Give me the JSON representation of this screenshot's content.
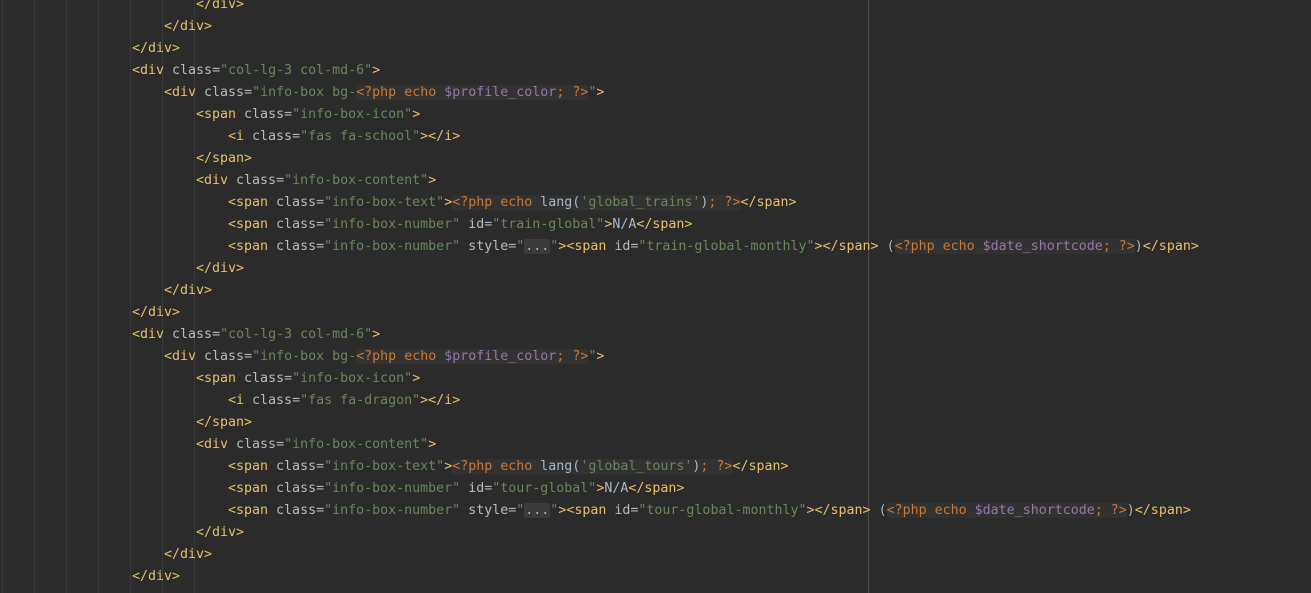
{
  "editor": {
    "language": "php",
    "lines": [
      [
        [
          "t",
          "</div>"
        ]
      ],
      [
        [
          "t",
          "</div>"
        ]
      ],
      [
        [
          "t",
          "</div>"
        ]
      ],
      [
        [
          "t",
          "<div "
        ],
        [
          "a",
          "class"
        ],
        [
          "o",
          "="
        ],
        [
          "s",
          "\"col-lg-3 col-md-6\""
        ],
        [
          "t",
          ">"
        ]
      ],
      [
        [
          "t",
          "<div "
        ],
        [
          "a",
          "class"
        ],
        [
          "o",
          "="
        ],
        [
          "s",
          "\"info-box bg-"
        ],
        [
          "php",
          "<?php "
        ],
        [
          "php",
          "echo "
        ],
        [
          "v",
          "$profile_color"
        ],
        [
          "php",
          "; ?>"
        ],
        [
          "s",
          "\""
        ],
        [
          "t",
          ">"
        ]
      ],
      [
        [
          "t",
          "<span "
        ],
        [
          "a",
          "class"
        ],
        [
          "o",
          "="
        ],
        [
          "s",
          "\"info-box-icon\""
        ],
        [
          "t",
          ">"
        ]
      ],
      [
        [
          "t",
          "<i "
        ],
        [
          "a",
          "class"
        ],
        [
          "o",
          "="
        ],
        [
          "s",
          "\"fas fa-school\""
        ],
        [
          "t",
          "></i>"
        ]
      ],
      [
        [
          "t",
          "</span>"
        ]
      ],
      [
        [
          "t",
          "<div "
        ],
        [
          "a",
          "class"
        ],
        [
          "o",
          "="
        ],
        [
          "s",
          "\"info-box-content\""
        ],
        [
          "t",
          ">"
        ]
      ],
      [
        [
          "t",
          "<span "
        ],
        [
          "a",
          "class"
        ],
        [
          "o",
          "="
        ],
        [
          "s",
          "\"info-box-text\""
        ],
        [
          "t",
          ">"
        ],
        [
          "php",
          "<?php "
        ],
        [
          "php",
          "echo "
        ],
        [
          "o",
          "lang("
        ],
        [
          "s",
          "'global_trains'"
        ],
        [
          "o",
          ")"
        ],
        [
          "php",
          "; ?>"
        ],
        [
          "t",
          "</span>"
        ]
      ],
      [
        [
          "t",
          "<span "
        ],
        [
          "a",
          "class"
        ],
        [
          "o",
          "="
        ],
        [
          "s",
          "\"info-box-number\" "
        ],
        [
          "a",
          "id"
        ],
        [
          "o",
          "="
        ],
        [
          "s",
          "\"train-global\""
        ],
        [
          "t",
          ">"
        ],
        [
          "o",
          "N/A"
        ],
        [
          "t",
          "</span>"
        ]
      ],
      [
        [
          "t",
          "<span "
        ],
        [
          "a",
          "class"
        ],
        [
          "o",
          "="
        ],
        [
          "s",
          "\"info-box-number\" "
        ],
        [
          "a",
          "style"
        ],
        [
          "o",
          "="
        ],
        [
          "s",
          "\""
        ],
        [
          "fold",
          "..."
        ],
        [
          "s",
          "\""
        ],
        [
          "t",
          "><span "
        ],
        [
          "a",
          "id"
        ],
        [
          "o",
          "="
        ],
        [
          "s",
          "\"train-global-monthly\""
        ],
        [
          "t",
          "></span>"
        ],
        [
          "o",
          " ("
        ],
        [
          "php",
          "<?php "
        ],
        [
          "php",
          "echo "
        ],
        [
          "v",
          "$date_shortcode"
        ],
        [
          "php",
          "; ?>"
        ],
        [
          "o",
          ")"
        ],
        [
          "t",
          "</span>"
        ]
      ],
      [
        [
          "t",
          "</div>"
        ]
      ],
      [
        [
          "t",
          "</div>"
        ]
      ],
      [
        [
          "t",
          "</div>"
        ]
      ],
      [
        [
          "t",
          "<div "
        ],
        [
          "a",
          "class"
        ],
        [
          "o",
          "="
        ],
        [
          "s",
          "\"col-lg-3 col-md-6\""
        ],
        [
          "t",
          ">"
        ]
      ],
      [
        [
          "t",
          "<div "
        ],
        [
          "a",
          "class"
        ],
        [
          "o",
          "="
        ],
        [
          "s",
          "\"info-box bg-"
        ],
        [
          "php",
          "<?php "
        ],
        [
          "php",
          "echo "
        ],
        [
          "v",
          "$profile_color"
        ],
        [
          "php",
          "; ?>"
        ],
        [
          "s",
          "\""
        ],
        [
          "t",
          ">"
        ]
      ],
      [
        [
          "t",
          "<span "
        ],
        [
          "a",
          "class"
        ],
        [
          "o",
          "="
        ],
        [
          "s",
          "\"info-box-icon\""
        ],
        [
          "t",
          ">"
        ]
      ],
      [
        [
          "t",
          "<i "
        ],
        [
          "a",
          "class"
        ],
        [
          "o",
          "="
        ],
        [
          "s",
          "\"fas fa-dragon\""
        ],
        [
          "t",
          "></i>"
        ]
      ],
      [
        [
          "t",
          "</span>"
        ]
      ],
      [
        [
          "t",
          "<div "
        ],
        [
          "a",
          "class"
        ],
        [
          "o",
          "="
        ],
        [
          "s",
          "\"info-box-content\""
        ],
        [
          "t",
          ">"
        ]
      ],
      [
        [
          "t",
          "<span "
        ],
        [
          "a",
          "class"
        ],
        [
          "o",
          "="
        ],
        [
          "s",
          "\"info-box-text\""
        ],
        [
          "t",
          ">"
        ],
        [
          "php",
          "<?php "
        ],
        [
          "php",
          "echo "
        ],
        [
          "o",
          "lang("
        ],
        [
          "s",
          "'global_tours'"
        ],
        [
          "o",
          ")"
        ],
        [
          "php",
          "; ?>"
        ],
        [
          "t",
          "</span>"
        ]
      ],
      [
        [
          "t",
          "<span "
        ],
        [
          "a",
          "class"
        ],
        [
          "o",
          "="
        ],
        [
          "s",
          "\"info-box-number\" "
        ],
        [
          "a",
          "id"
        ],
        [
          "o",
          "="
        ],
        [
          "s",
          "\"tour-global\""
        ],
        [
          "t",
          ">"
        ],
        [
          "o",
          "N/A"
        ],
        [
          "t",
          "</span>"
        ]
      ],
      [
        [
          "t",
          "<span "
        ],
        [
          "a",
          "class"
        ],
        [
          "o",
          "="
        ],
        [
          "s",
          "\"info-box-number\" "
        ],
        [
          "a",
          "style"
        ],
        [
          "o",
          "="
        ],
        [
          "s",
          "\""
        ],
        [
          "fold",
          "..."
        ],
        [
          "s",
          "\""
        ],
        [
          "t",
          "><span "
        ],
        [
          "a",
          "id"
        ],
        [
          "o",
          "="
        ],
        [
          "s",
          "\"tour-global-monthly\""
        ],
        [
          "t",
          "></span>"
        ],
        [
          "o",
          " ("
        ],
        [
          "php",
          "<?php "
        ],
        [
          "php",
          "echo "
        ],
        [
          "v",
          "$date_shortcode"
        ],
        [
          "php",
          "; ?>"
        ],
        [
          "o",
          ")"
        ],
        [
          "t",
          "</span>"
        ]
      ],
      [
        [
          "t",
          "</div>"
        ]
      ],
      [
        [
          "t",
          "</div>"
        ]
      ],
      [
        [
          "t",
          "</div>"
        ]
      ]
    ]
  }
}
